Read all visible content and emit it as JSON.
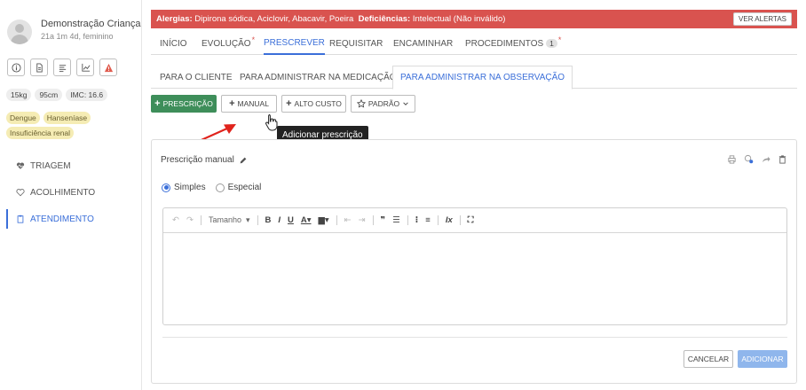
{
  "patient": {
    "name": "Demonstração Criança",
    "info": "21a 1m 4d, feminino",
    "measurements": [
      "15kg",
      "95cm",
      "IMC: 16.6"
    ],
    "diagnoses": [
      "Dengue",
      "Hanseníase",
      "Insuficiência renal"
    ]
  },
  "sidebar_nav": [
    {
      "label": "TRIAGEM",
      "icon": "heart-pulse-icon"
    },
    {
      "label": "ACOLHIMENTO",
      "icon": "heart-icon"
    },
    {
      "label": "ATENDIMENTO",
      "icon": "clipboard-icon",
      "active": true
    }
  ],
  "alerts": {
    "allergies_label": "Alergias:",
    "allergies": "Dipirona sódica, Aciclovir, Abacavir, Poeira",
    "deficiencies_label": "Deficiências:",
    "deficiencies": "Intelectual (Não inválido)",
    "button": "VER ALERTAS"
  },
  "main_tabs": [
    {
      "label": "INÍCIO"
    },
    {
      "label": "EVOLUÇÃO",
      "marker": "*"
    },
    {
      "label": "PRESCREVER",
      "active": true
    },
    {
      "label": "REQUISITAR"
    },
    {
      "label": "ENCAMINHAR"
    },
    {
      "label": "PROCEDIMENTOS",
      "badge": "1",
      "marker": "*"
    }
  ],
  "sub_tabs": [
    {
      "label": "PARA O CLIENTE"
    },
    {
      "label": "PARA ADMINISTRAR NA MEDICAÇÃO"
    },
    {
      "label": "PARA ADMINISTRAR NA OBSERVAÇÃO",
      "active": true
    }
  ],
  "actions": {
    "prescricao": "PRESCRIÇÃO",
    "manual": "MANUAL",
    "alto_custo": "ALTO CUSTO",
    "padrao": "PADRÃO"
  },
  "tooltip": "Adicionar prescrição",
  "panel": {
    "title": "Prescrição manual",
    "radio_simple": "Simples",
    "radio_special": "Especial",
    "toolbar_size": "Tamanho",
    "cancel": "CANCELAR",
    "add": "ADICIONAR"
  },
  "colors": {
    "alert": "#d9534f",
    "accent": "#3b6fd9",
    "primary_green": "#3e8e5a",
    "diagnosis_chip": "#f5ecb4"
  }
}
